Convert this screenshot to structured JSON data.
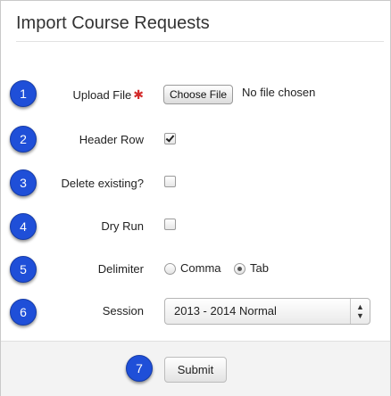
{
  "page": {
    "title": "Import Course Requests"
  },
  "steps": [
    "1",
    "2",
    "3",
    "4",
    "5",
    "6",
    "7"
  ],
  "fields": {
    "upload_file": {
      "label": "Upload File",
      "required_mark": "✱",
      "button": "Choose File",
      "status": "No file chosen"
    },
    "header_row": {
      "label": "Header Row",
      "checked": true
    },
    "delete_existing": {
      "label": "Delete existing?",
      "checked": false
    },
    "dry_run": {
      "label": "Dry Run",
      "checked": false
    },
    "delimiter": {
      "label": "Delimiter",
      "options": [
        "Comma",
        "Tab"
      ],
      "selected": "Tab"
    },
    "session": {
      "label": "Session",
      "value": "2013 - 2014 Normal"
    }
  },
  "actions": {
    "submit": "Submit"
  },
  "colors": {
    "step_badge": "#1f4fd8",
    "required": "#d32b2b"
  }
}
